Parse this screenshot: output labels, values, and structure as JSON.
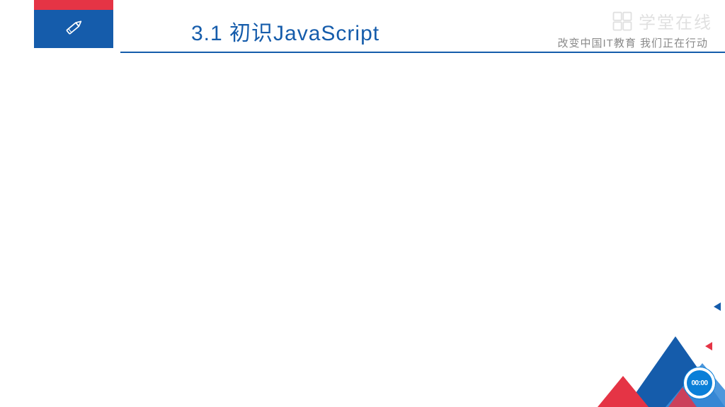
{
  "header": {
    "title": "3.1 初识JavaScript",
    "subtitle": "改变中国IT教育  我们正在行动"
  },
  "watermark": {
    "brand": "学堂在线"
  },
  "timer": {
    "value": "00:00"
  },
  "colors": {
    "blue": "#155cab",
    "red": "#e53445",
    "lightblue": "#3a8cd8",
    "cyan": "#0a7fd8"
  }
}
